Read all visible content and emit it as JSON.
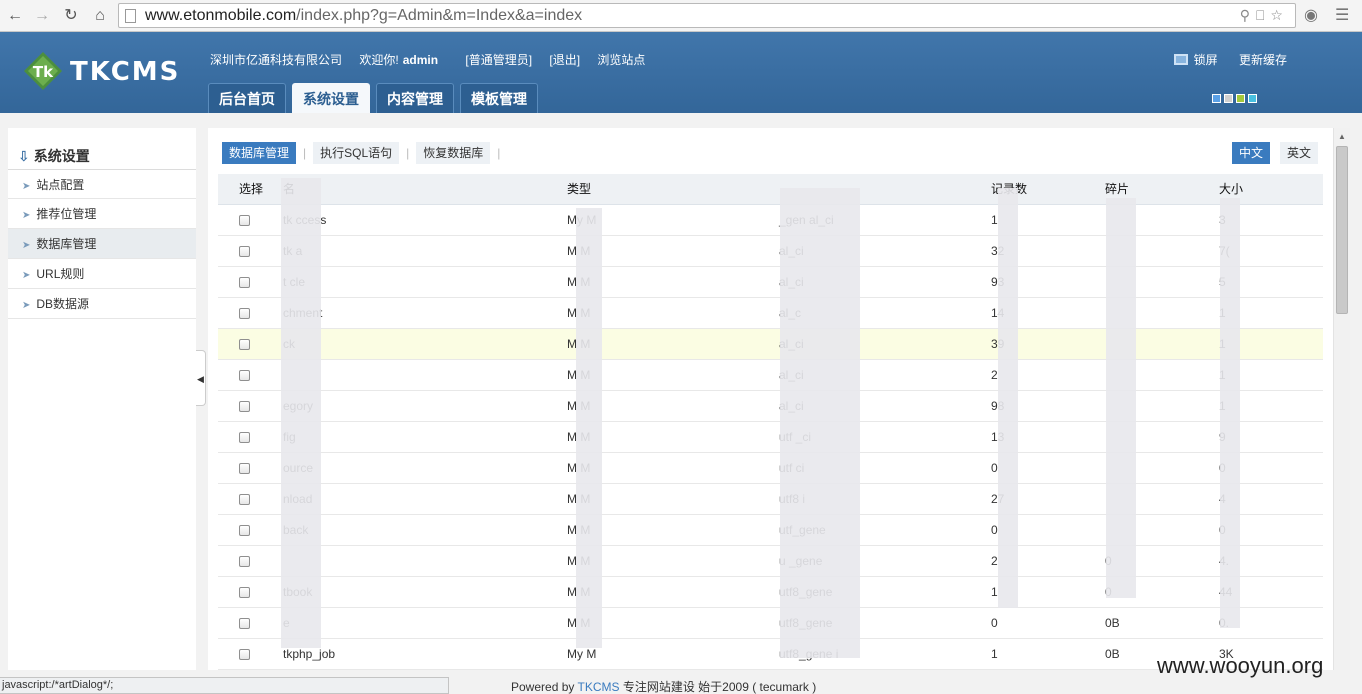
{
  "browser": {
    "url_host": "www.etonmobile.com",
    "url_path": "/index.php?g=Admin&m=Index&a=index"
  },
  "header": {
    "logo_text": "TKCMS",
    "company": "深圳市亿通科技有限公司",
    "welcome": "欢迎你!",
    "username": "admin",
    "role": "[普通管理员]",
    "logout": "[退出]",
    "browse_site": "浏览站点",
    "lock_screen": "锁屏",
    "update_cache": "更新缓存",
    "tabs": [
      {
        "label": "后台首页"
      },
      {
        "label": "系统设置"
      },
      {
        "label": "内容管理"
      },
      {
        "label": "模板管理"
      }
    ],
    "skin_colors": [
      "#5aa0e6",
      "#d0d0d0",
      "#a4c93c",
      "#48c0e0"
    ]
  },
  "sidebar": {
    "title": "系统设置",
    "items": [
      {
        "label": "站点配置"
      },
      {
        "label": "推荐位管理"
      },
      {
        "label": "数据库管理"
      },
      {
        "label": "URL规则"
      },
      {
        "label": "DB数据源"
      }
    ]
  },
  "content": {
    "sub_tabs": [
      {
        "label": "数据库管理"
      },
      {
        "label": "执行SQL语句"
      },
      {
        "label": "恢复数据库"
      }
    ],
    "languages": [
      {
        "label": "中文"
      },
      {
        "label": "英文"
      }
    ],
    "table": {
      "headers": [
        "选择",
        "名",
        "类型",
        "",
        "记录数",
        "碎片",
        "大小"
      ],
      "rows": [
        {
          "name": "tk     ccess",
          "type": "My     M",
          "coll": "  _gen  al_ci",
          "rows": "1",
          "frag": "",
          "size": "3"
        },
        {
          "name": "tk      a",
          "type": "M      M",
          "coll": "      al_ci",
          "rows": "32",
          "frag": "",
          "size": "7("
        },
        {
          "name": "t      cle",
          "type": "M      M",
          "coll": "      al_ci",
          "rows": "93",
          "frag": "",
          "size": "5"
        },
        {
          "name": "      chment",
          "type": "M      M",
          "coll": "      al_c",
          "rows": "14",
          "frag": "",
          "size": "1"
        },
        {
          "name": "      ck",
          "type": "M      M",
          "coll": "      al_ci",
          "rows": "39",
          "frag": "",
          "size": "1"
        },
        {
          "name": "",
          "type": "M      M",
          "coll": "      al_ci",
          "rows": "2",
          "frag": "",
          "size": "1"
        },
        {
          "name": "      egory",
          "type": "M      M",
          "coll": "      al_ci",
          "rows": "98",
          "frag": "",
          "size": "1"
        },
        {
          "name": "      fig",
          "type": "M      M",
          "coll": "utf      _ci",
          "rows": "13",
          "frag": "",
          "size": "9"
        },
        {
          "name": "      ource",
          "type": "M      M",
          "coll": "utf      ci",
          "rows": "0",
          "frag": "",
          "size": "0"
        },
        {
          "name": "      nload",
          "type": "M      M",
          "coll": "utf8      i",
          "rows": "27",
          "frag": "",
          "size": "4"
        },
        {
          "name": "      back",
          "type": "M      M",
          "coll": "utf_gene",
          "rows": "0",
          "frag": "",
          "size": "0"
        },
        {
          "name": "",
          "type": "M      M",
          "coll": "u  _gene",
          "rows": "2",
          "frag": "0",
          "size": "4."
        },
        {
          "name": "      tbook",
          "type": "M      M",
          "coll": "utf8_gene",
          "rows": "1",
          "frag": "0",
          "size": "44"
        },
        {
          "name": "      e",
          "type": "M      M",
          "coll": "utf8_gene",
          "rows": "0",
          "frag": "0B",
          "size": "0."
        },
        {
          "name": "tkphp_job",
          "type": "My      M",
          "coll": "utf8_gene      i",
          "rows": "1",
          "frag": "0B",
          "size": "3K"
        }
      ]
    }
  },
  "status_bar": "javascript:/*artDialog*/;",
  "footer": {
    "powered": "Powered by",
    "brand": "TKCMS",
    "rest": "专注网站建设  始于2009 ( tecumark )"
  },
  "watermark": "www.wooyun.org"
}
